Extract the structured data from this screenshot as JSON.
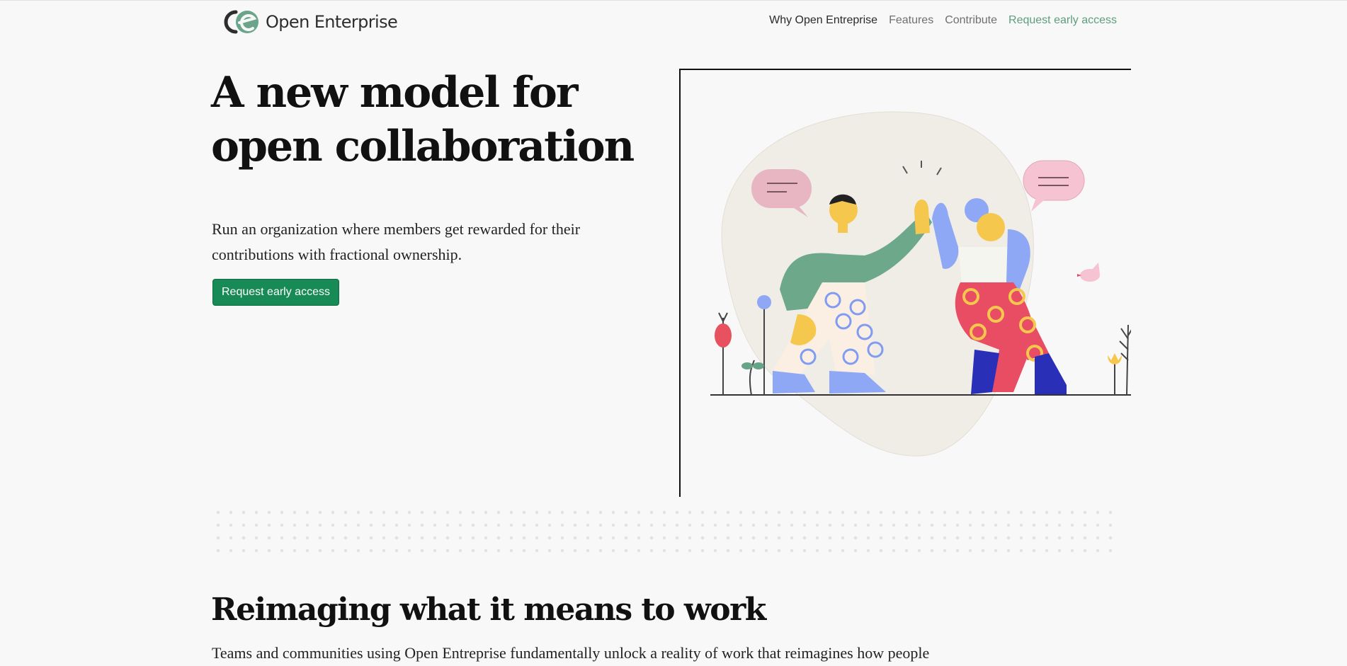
{
  "brand": {
    "name": "Open Enterprise",
    "logo_icon": "open-enterprise-logo-icon"
  },
  "nav": {
    "items": [
      {
        "label": "Why Open Entreprise",
        "state": "active"
      },
      {
        "label": "Features",
        "state": "default"
      },
      {
        "label": "Contribute",
        "state": "default"
      },
      {
        "label": "Request early access",
        "state": "accent"
      }
    ]
  },
  "hero": {
    "title_line1": "A new model for",
    "title_line2": "open collaboration",
    "description": "Run an organization where members get rewarded for their contributions with fractional ownership.",
    "cta_label": "Request early access",
    "illustration": "high-five-illustration"
  },
  "section": {
    "title": "Reimaging what it means to work",
    "text": "Teams and communities using Open Entreprise fundamentally unlock a reality of work that reimagines how people"
  },
  "colors": {
    "background": "#f8f8f8",
    "cta": "#178a55",
    "accent": "#5d9e7c",
    "text": "#111111"
  }
}
